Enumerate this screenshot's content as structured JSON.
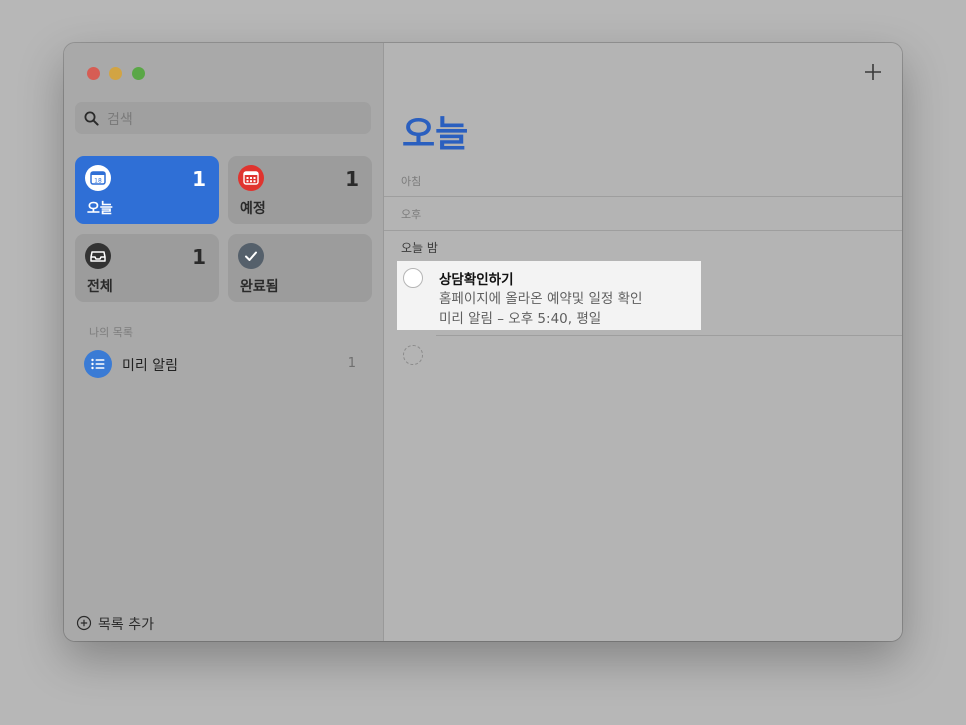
{
  "colors": {
    "today_accent": "#2f6fd6",
    "title_blue": "#2a5fbf",
    "scheduled_red": "#e0342f",
    "all_dark": "#3a3a3a",
    "completed_gray": "#5b6470",
    "list_blue": "#3a7bd5"
  },
  "sidebar": {
    "search": {
      "placeholder": "검색",
      "icon": "search-icon"
    },
    "cards": {
      "today": {
        "label": "오늘",
        "count": "1",
        "icon": "calendar-icon",
        "day": "18"
      },
      "scheduled": {
        "label": "예정",
        "count": "1",
        "icon": "calendar-grid-icon"
      },
      "all": {
        "label": "전체",
        "count": "1",
        "icon": "tray-icon"
      },
      "completed": {
        "label": "완료됨",
        "count": "",
        "icon": "checkmark-icon"
      }
    },
    "section_label": "나의 목록",
    "lists": [
      {
        "name": "미리 알림",
        "count": "1",
        "icon": "list-bullet-icon"
      }
    ],
    "add_list_label": "목록 추가"
  },
  "main": {
    "title": "오늘",
    "groups": {
      "morning": "아침",
      "afternoon": "오후",
      "tonight": "오늘 밤"
    },
    "task": {
      "title": "상담확인하기",
      "notes": "홈페이지에 올라온 예약및 일정 확인",
      "alarm": "미리 알림 – 오후 5:40, 평일"
    }
  }
}
